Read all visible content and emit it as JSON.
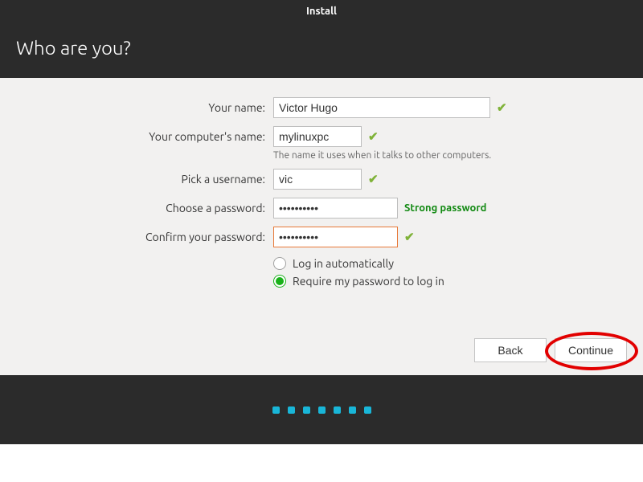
{
  "window": {
    "title": "Install"
  },
  "page": {
    "heading": "Who are you?"
  },
  "form": {
    "name": {
      "label": "Your name:",
      "value": "Victor Hugo"
    },
    "computer": {
      "label": "Your computer's name:",
      "value": "mylinuxpc",
      "helper": "The name it uses when it talks to other computers."
    },
    "username": {
      "label": "Pick a username:",
      "value": "vic"
    },
    "password": {
      "label": "Choose a password:",
      "value": "••••••••••",
      "strength": "Strong password"
    },
    "confirm": {
      "label": "Confirm your password:",
      "value": "••••••••••"
    },
    "radios": {
      "auto": "Log in automatically",
      "require": "Require my password to log in"
    }
  },
  "buttons": {
    "back": "Back",
    "continue": "Continue"
  },
  "pager": {
    "count": 7
  }
}
